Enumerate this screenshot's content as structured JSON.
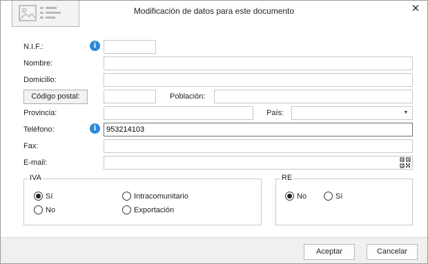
{
  "dialog": {
    "title": "Modificación de datos para este documento",
    "close_glyph": "✕"
  },
  "icons": {
    "logo": "card-placeholder-icon",
    "info": "info-icon",
    "qr": "qr-code-icon",
    "dropdown": "chevron-down-icon"
  },
  "info_glyph": "i",
  "fields": {
    "nif": {
      "label": "N.I.F.:",
      "value": ""
    },
    "nombre": {
      "label": "Nombre:",
      "value": ""
    },
    "domicilio": {
      "label": "Domicilio:",
      "value": ""
    },
    "codigo_postal": {
      "button_label": "Código postal:",
      "value": ""
    },
    "poblacion": {
      "label": "Población:",
      "value": ""
    },
    "provincia": {
      "label": "Provincia:",
      "value": ""
    },
    "pais": {
      "label": "País:",
      "value": ""
    },
    "telefono": {
      "label": "Teléfono:",
      "value": "953214103"
    },
    "fax": {
      "label": "Fax:",
      "value": ""
    },
    "email": {
      "label": "E-mail:",
      "value": ""
    }
  },
  "iva": {
    "title": "IVA",
    "options": [
      "Sí",
      "No",
      "Intracomunitario",
      "Exportación"
    ],
    "selected": "Sí"
  },
  "re": {
    "title": "RE",
    "options": [
      "No",
      "Sí"
    ],
    "selected": "No"
  },
  "buttons": {
    "accept": "Aceptar",
    "cancel": "Cancelar"
  },
  "colors": {
    "info_accent": "#2a88d8",
    "footer_bg": "#f0f0f0"
  }
}
